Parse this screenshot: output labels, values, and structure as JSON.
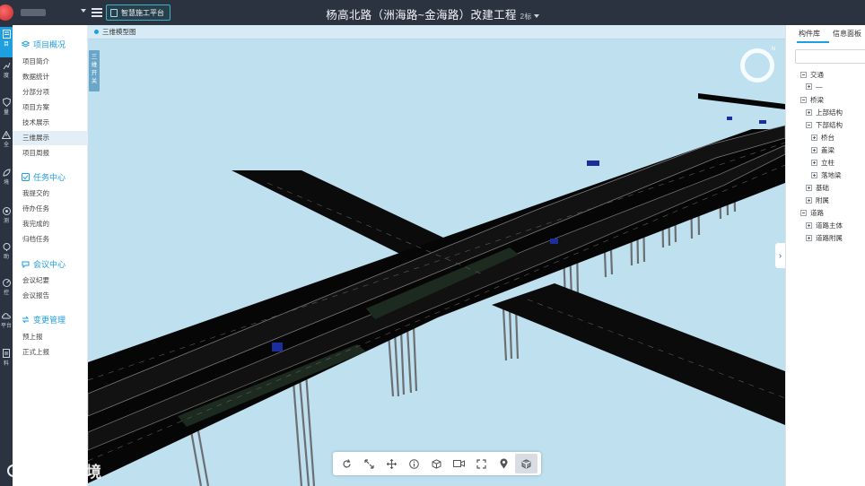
{
  "header": {
    "title": "杨高北路（洲海路~金海路）改建工程",
    "section_selector": "2标",
    "platform_button": "智慧施工平台"
  },
  "iconbar": {
    "items": [
      {
        "icon": "project-icon",
        "label": "目"
      },
      {
        "icon": "progress-icon",
        "label": "度"
      },
      {
        "icon": "quality-icon",
        "label": "量"
      },
      {
        "icon": "safety-icon",
        "label": "全"
      },
      {
        "icon": "environment-icon",
        "label": "境"
      },
      {
        "icon": "monitor-icon",
        "label": "测"
      },
      {
        "icon": "assist-icon",
        "label": "助"
      },
      {
        "icon": "control-icon",
        "label": "控"
      },
      {
        "icon": "platform-icon",
        "label": "平台"
      },
      {
        "icon": "docs-icon",
        "label": "料"
      }
    ]
  },
  "sidenav": {
    "sections": [
      {
        "title": "项目概况",
        "icon": "layers-icon",
        "items": [
          "项目简介",
          "数据统计",
          "分部分项",
          "项目方案",
          "技术展示",
          "三维展示",
          "项目周报"
        ]
      },
      {
        "title": "任务中心",
        "icon": "task-icon",
        "items": [
          "我提交的",
          "待办任务",
          "我完成的",
          "归档任务"
        ]
      },
      {
        "title": "会议中心",
        "icon": "meeting-icon",
        "items": [
          "会议纪要",
          "会议报告"
        ]
      },
      {
        "title": "变更管理",
        "icon": "change-icon",
        "items": [
          "预上报",
          "正式上报"
        ]
      }
    ],
    "active_item": "三维展示"
  },
  "viewer": {
    "tab_label": "三维模型图",
    "side_tab": "三维开关",
    "compass_label": "N",
    "toolbar": [
      "rotate-icon",
      "zoom-extent-icon",
      "pan-icon",
      "info-icon",
      "model-icon",
      "camera-icon",
      "fullscreen-icon",
      "location-icon",
      "cube-view-icon"
    ],
    "watermark": "大数据境"
  },
  "rpanel": {
    "tabs": [
      "构件库",
      "信息面板"
    ],
    "tree": [
      {
        "label": "交通",
        "level": 0,
        "state": "minus"
      },
      {
        "label": "—",
        "level": 1,
        "state": "plus"
      },
      {
        "label": "桥梁",
        "level": 0,
        "state": "minus"
      },
      {
        "label": "上部结构",
        "level": 1,
        "state": "plus"
      },
      {
        "label": "下部结构",
        "level": 1,
        "state": "minus"
      },
      {
        "label": "桥台",
        "level": 2,
        "state": "plus"
      },
      {
        "label": "盖梁",
        "level": 2,
        "state": "plus"
      },
      {
        "label": "立柱",
        "level": 2,
        "state": "plus"
      },
      {
        "label": "落地梁",
        "level": 2,
        "state": "plus"
      },
      {
        "label": "基础",
        "level": 1,
        "state": "plus"
      },
      {
        "label": "附属",
        "level": 1,
        "state": "plus"
      },
      {
        "label": "道路",
        "level": 0,
        "state": "minus"
      },
      {
        "label": "道路主体",
        "level": 1,
        "state": "plus"
      },
      {
        "label": "道路附属",
        "level": 1,
        "state": "plus"
      }
    ]
  }
}
